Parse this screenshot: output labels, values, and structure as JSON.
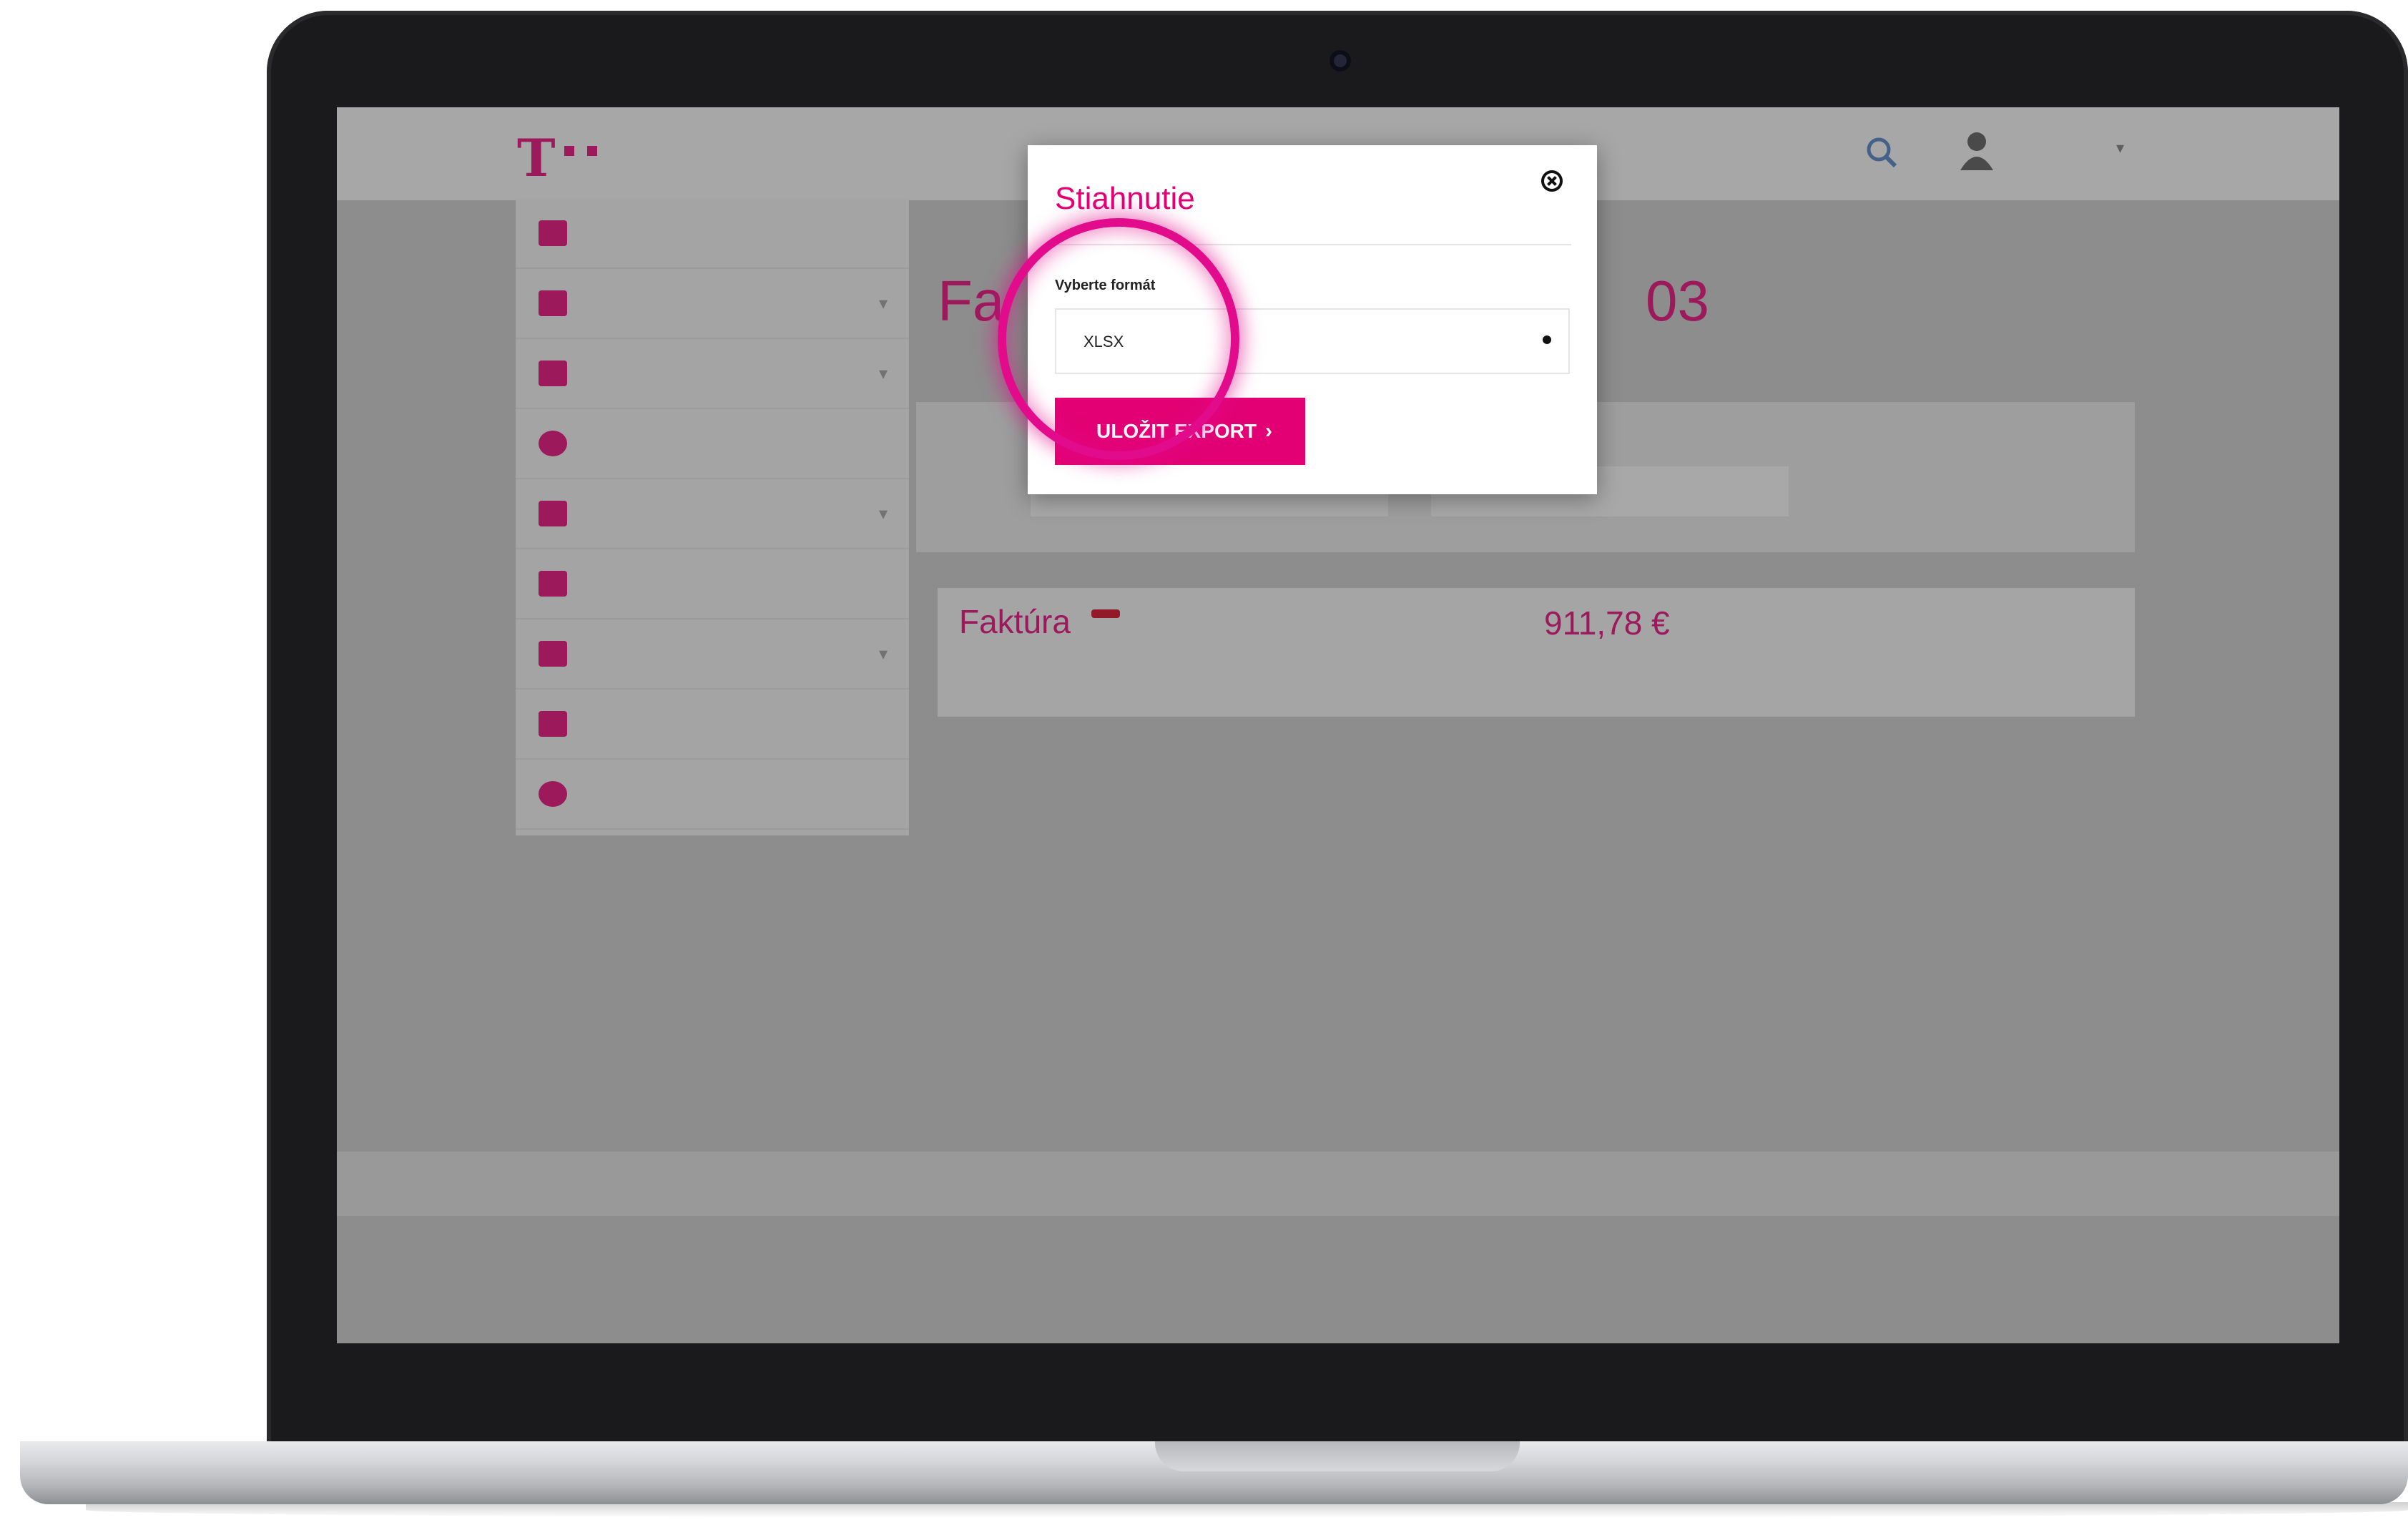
{
  "modal": {
    "title": "Stiahnutie",
    "format_label": "Vyberte formát",
    "selected_format": "XLSX",
    "export_button": "ULOŽIT EXPORT"
  },
  "colors": {
    "brand_magenta": "#e20074",
    "highlight_ring": "#e20b8c",
    "badge_red": "#d0021b"
  },
  "icons": [
    "close-icon",
    "dropdown-arrow-icon",
    "chevron-right-icon",
    "search-icon",
    "user-avatar-icon",
    "telekom-logo"
  ],
  "page": {
    "title_start": "Fa",
    "title_end": "03",
    "invoice": {
      "title": "Faktúra",
      "amount": "911,78 €"
    }
  },
  "background_page_readable": false
}
